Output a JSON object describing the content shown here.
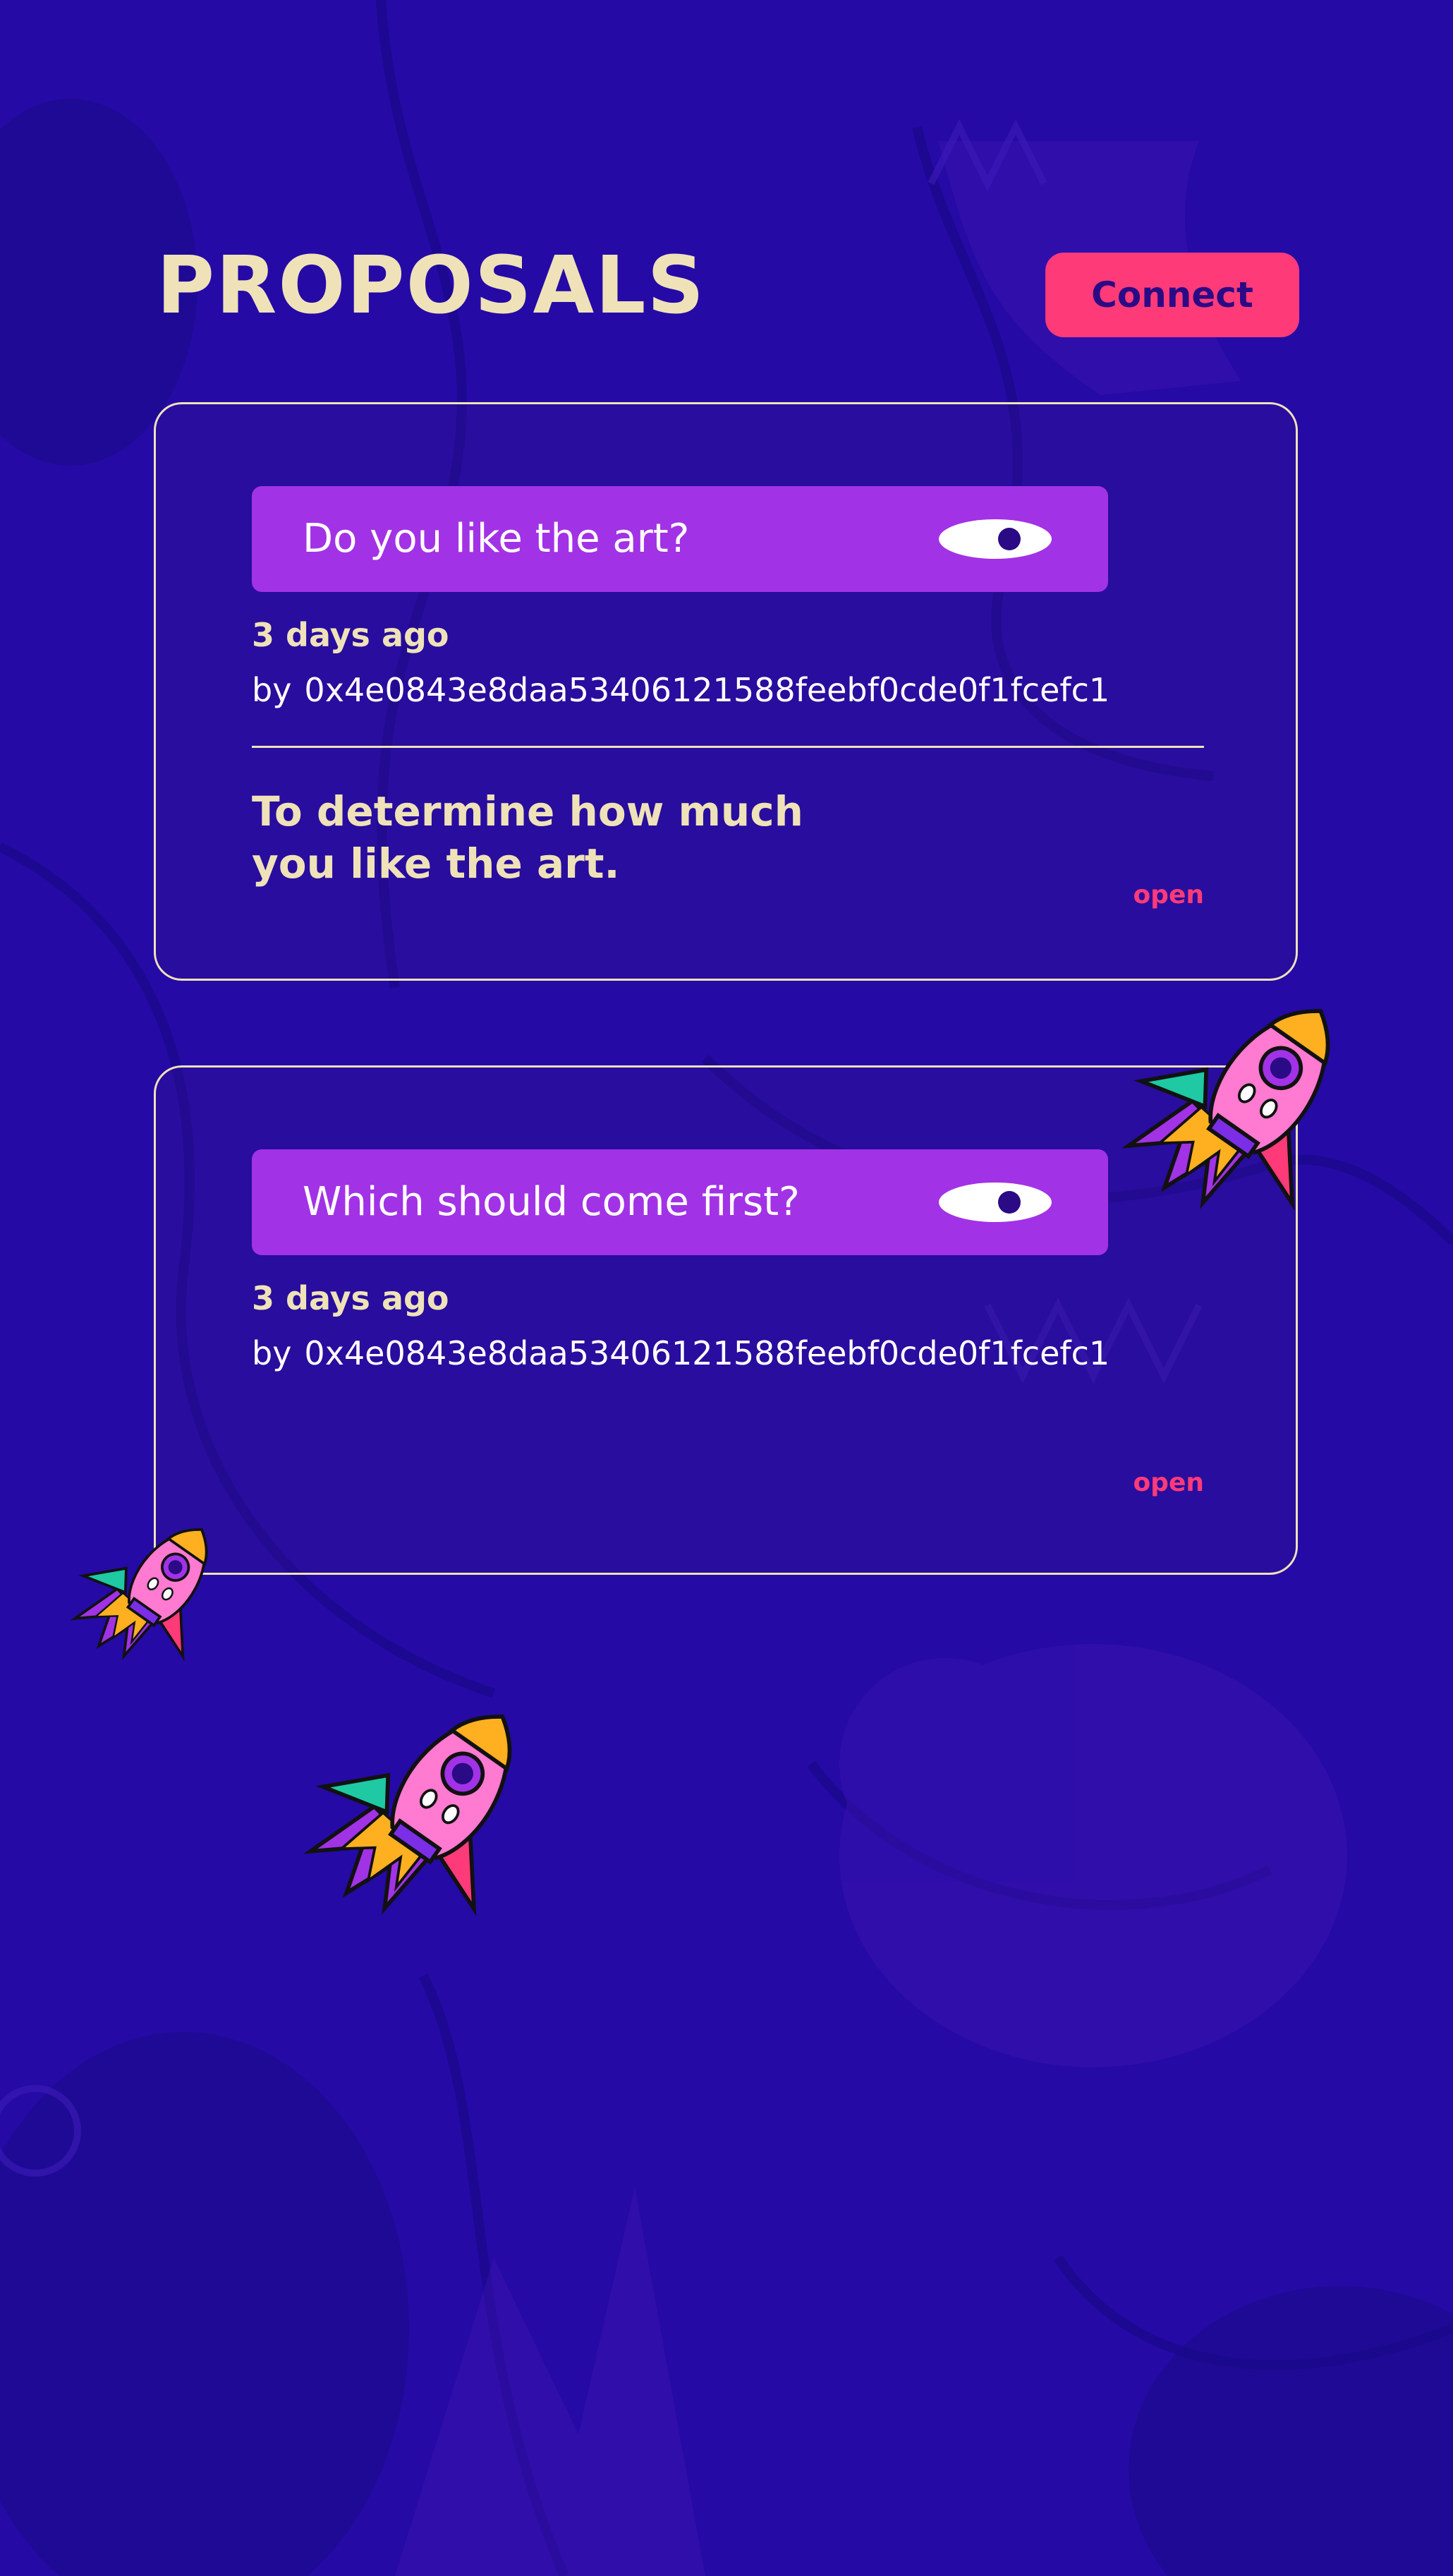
{
  "header": {
    "title": "PROPOSALS",
    "connect_label": "Connect"
  },
  "proposals": [
    {
      "question": "Do you like the art?",
      "time_ago": "3 days ago",
      "author_prefix": "by",
      "author": "0x4e0843e8daa53406121588feebf0cde0f1fcefc1",
      "description": "To determine how much you like the art.",
      "status": "open"
    },
    {
      "question": "Which should come first?",
      "time_ago": "3 days ago",
      "author_prefix": "by",
      "author": "0x4e0843e8daa53406121588feebf0cde0f1fcefc1",
      "description": "",
      "status": "open"
    }
  ],
  "icons": {
    "view": "eye-icon",
    "decoration": "rocket-illustration"
  },
  "colors": {
    "background": "#250aa6",
    "title": "#efe2b8",
    "accent": "#ff3a79",
    "question_bar": "#a232e6",
    "text": "#ffffff"
  }
}
